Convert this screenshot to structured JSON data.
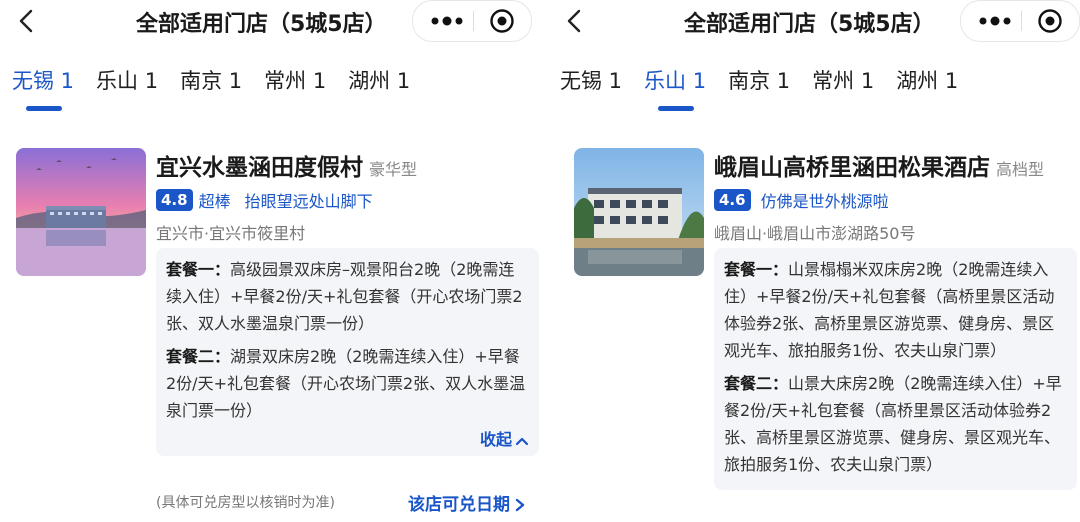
{
  "panels": [
    {
      "title": "全部适用门店（5城5店）",
      "tabs": [
        {
          "label": "无锡 1",
          "active": true
        },
        {
          "label": "乐山 1",
          "active": false
        },
        {
          "label": "南京 1",
          "active": false
        },
        {
          "label": "常州 1",
          "active": false
        },
        {
          "label": "湖州 1",
          "active": false
        }
      ],
      "store": {
        "name": "宜兴水墨涵田度假村",
        "grade": "豪华型",
        "score": "4.8",
        "score_label": "超棒",
        "quote": "抬眼望远处山脚下",
        "address": "宜兴市·宜兴市筱里村",
        "packages": [
          {
            "label": "套餐一：",
            "text": "高级园景双床房–观景阳台2晚（2晚需连续入住）+早餐2份/天+礼包套餐（开心农场门票2张、双人水墨温泉门票一份）"
          },
          {
            "label": "套餐二：",
            "text": "湖景双床房2晚（2晚需连续入住）+早餐2份/天+礼包套餐（开心农场门票2张、双人水墨温泉门票一份）"
          }
        ],
        "collapse_label": "收起",
        "note": "(具体可兑房型以核销时为准)",
        "dates_label": "该店可兑日期"
      }
    },
    {
      "title": "全部适用门店（5城5店）",
      "tabs": [
        {
          "label": "无锡 1",
          "active": false
        },
        {
          "label": "乐山 1",
          "active": true
        },
        {
          "label": "南京 1",
          "active": false
        },
        {
          "label": "常州 1",
          "active": false
        },
        {
          "label": "湖州 1",
          "active": false
        }
      ],
      "store": {
        "name": "峨眉山高桥里涵田松果酒店",
        "grade": "高档型",
        "score": "4.6",
        "score_label": "",
        "quote": "仿佛是世外桃源啦",
        "address": "峨眉山·峨眉山市澎湖路50号",
        "packages": [
          {
            "label": "套餐一：",
            "text": "山景榻榻米双床房2晚（2晚需连续入住）+早餐2份/天+礼包套餐（高桥里景区活动体验券2张、高桥里景区游览票、健身房、景区观光车、旅拍服务1份、农夫山泉门票）"
          },
          {
            "label": "套餐二：",
            "text": "山景大床房2晚（2晚需连续入住）+早餐2份/天+礼包套餐（高桥里景区活动体验券2张、高桥里景区游览票、健身房、景区观光车、旅拍服务1份、农夫山泉门票）"
          }
        ]
      }
    }
  ],
  "colors": {
    "accent": "#1a56c8",
    "package_bg": "#f4f5f8"
  },
  "icons": [
    "back-arrow-icon",
    "more-dots-icon",
    "target-circle-icon",
    "chevron-up-icon",
    "chevron-right-icon"
  ]
}
